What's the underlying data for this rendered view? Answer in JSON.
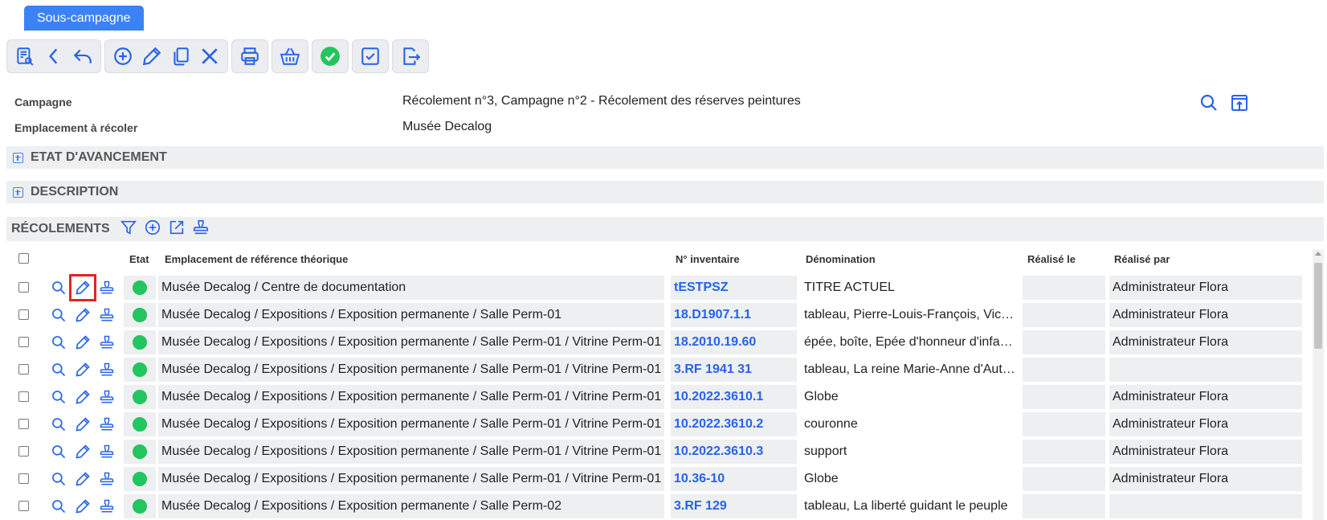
{
  "tab": {
    "label": "Sous-campagne"
  },
  "fields": {
    "campagne_label": "Campagne",
    "campagne_value": "Récolement n°3, Campagne n°2 - Récolement des réserves peintures",
    "emplacement_label": "Emplacement à récoler",
    "emplacement_value": "Musée Decalog"
  },
  "sections": {
    "etat": "ETAT D'AVANCEMENT",
    "description": "DESCRIPTION",
    "recolements": "RÉCOLEMENTS"
  },
  "table": {
    "headers": {
      "etat": "Etat",
      "emplacement": "Emplacement de référence théorique",
      "inventaire": "N° inventaire",
      "denomination": "Dénomination",
      "realise_le": "Réalisé le",
      "realise_par": "Réalisé par"
    },
    "rows": [
      {
        "emplacement": "Musée Decalog / Centre de documentation",
        "inventaire": "tESTPSZ",
        "denomination": "TITRE ACTUEL",
        "realise_le": "",
        "realise_par": "Administrateur Flora"
      },
      {
        "emplacement": "Musée Decalog / Expositions / Exposition permanente / Salle Perm-01",
        "inventaire": "18.D1907.1.1",
        "denomination": "tableau, Pierre-Louis-François, Vicomte de Bervil…",
        "realise_le": "",
        "realise_par": "Administrateur Flora"
      },
      {
        "emplacement": "Musée Decalog / Expositions / Exposition permanente / Salle Perm-01 / Vitrine Perm-01",
        "inventaire": "18.2010.19.60",
        "denomination": "épée, boîte, Epée d'honneur d'infanterie",
        "realise_le": "",
        "realise_par": "Administrateur Flora"
      },
      {
        "emplacement": "Musée Decalog / Expositions / Exposition permanente / Salle Perm-01 / Vitrine Perm-01",
        "inventaire": "3.RF 1941 31",
        "denomination": "tableau, La reine Marie-Anne d'Autriche",
        "realise_le": "",
        "realise_par": ""
      },
      {
        "emplacement": "Musée Decalog / Expositions / Exposition permanente / Salle Perm-01 / Vitrine Perm-01",
        "inventaire": "10.2022.3610.1",
        "denomination": "Globe",
        "realise_le": "",
        "realise_par": "Administrateur Flora"
      },
      {
        "emplacement": "Musée Decalog / Expositions / Exposition permanente / Salle Perm-01 / Vitrine Perm-01",
        "inventaire": "10.2022.3610.2",
        "denomination": "couronne",
        "realise_le": "",
        "realise_par": "Administrateur Flora"
      },
      {
        "emplacement": "Musée Decalog / Expositions / Exposition permanente / Salle Perm-01 / Vitrine Perm-01",
        "inventaire": "10.2022.3610.3",
        "denomination": "support",
        "realise_le": "",
        "realise_par": "Administrateur Flora"
      },
      {
        "emplacement": "Musée Decalog / Expositions / Exposition permanente / Salle Perm-01 / Vitrine Perm-01",
        "inventaire": "10.36-10",
        "denomination": "Globe",
        "realise_le": "",
        "realise_par": "Administrateur Flora"
      },
      {
        "emplacement": "Musée Decalog / Expositions / Exposition permanente / Salle Perm-02",
        "inventaire": "3.RF 129",
        "denomination": "tableau, La liberté guidant le peuple",
        "realise_le": "",
        "realise_par": ""
      }
    ]
  },
  "colors": {
    "accent": "#3b82f6",
    "link": "#2563eb",
    "status_ok": "#22c55e",
    "highlight": "#e02424"
  }
}
